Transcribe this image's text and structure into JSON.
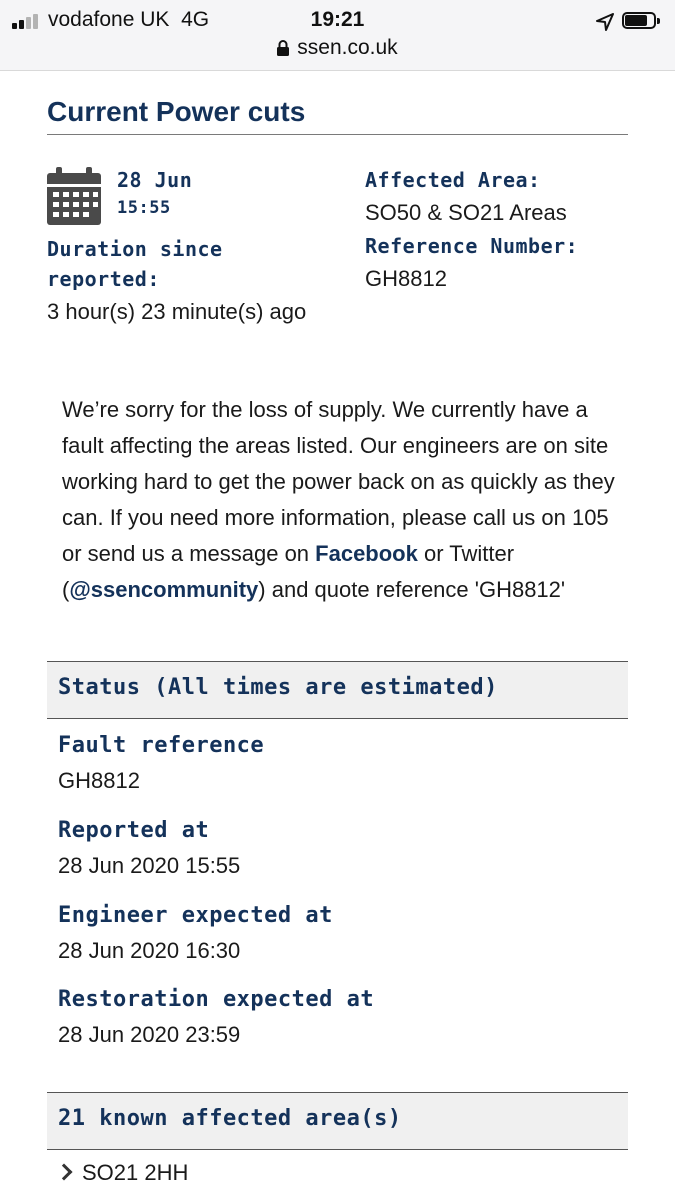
{
  "status_bar": {
    "carrier": "vodafone UK",
    "network": "4G",
    "time": "19:21",
    "url": "ssen.co.uk"
  },
  "page": {
    "title": "Current Power cuts"
  },
  "summary": {
    "date": "28 Jun",
    "time": "15:55",
    "duration_label": "Duration since reported:",
    "duration_value": "3 hour(s) 23 minute(s) ago",
    "affected_label": "Affected Area:",
    "affected_value": "SO50 & SO21 Areas",
    "reference_label": "Reference Number:",
    "reference_value": "GH8812"
  },
  "message": {
    "part1": "We’re sorry for the loss of supply. We currently have a fault affecting the areas listed. Our engineers are on site working hard to get the power back on as quickly as they can. If you need more information, please call us on 105 or send us a message on ",
    "facebook_link": "Facebook",
    "part2": " or Twitter (",
    "twitter_link": "@ssencommunity",
    "part3": ") and quote reference 'GH8812'"
  },
  "status_section": {
    "heading": "Status (All times are estimated)",
    "rows": [
      {
        "label": "Fault reference",
        "value": "GH8812"
      },
      {
        "label": "Reported at",
        "value": "28 Jun 2020 15:55"
      },
      {
        "label": "Engineer expected at",
        "value": "28 Jun 2020 16:30"
      },
      {
        "label": "Restoration expected at",
        "value": "28 Jun 2020 23:59"
      }
    ]
  },
  "areas_section": {
    "heading": "21 known affected area(s)",
    "items": [
      "SO21 2HH"
    ]
  },
  "colors": {
    "navy": "#14325a",
    "section_bg": "#f0f0f0"
  }
}
